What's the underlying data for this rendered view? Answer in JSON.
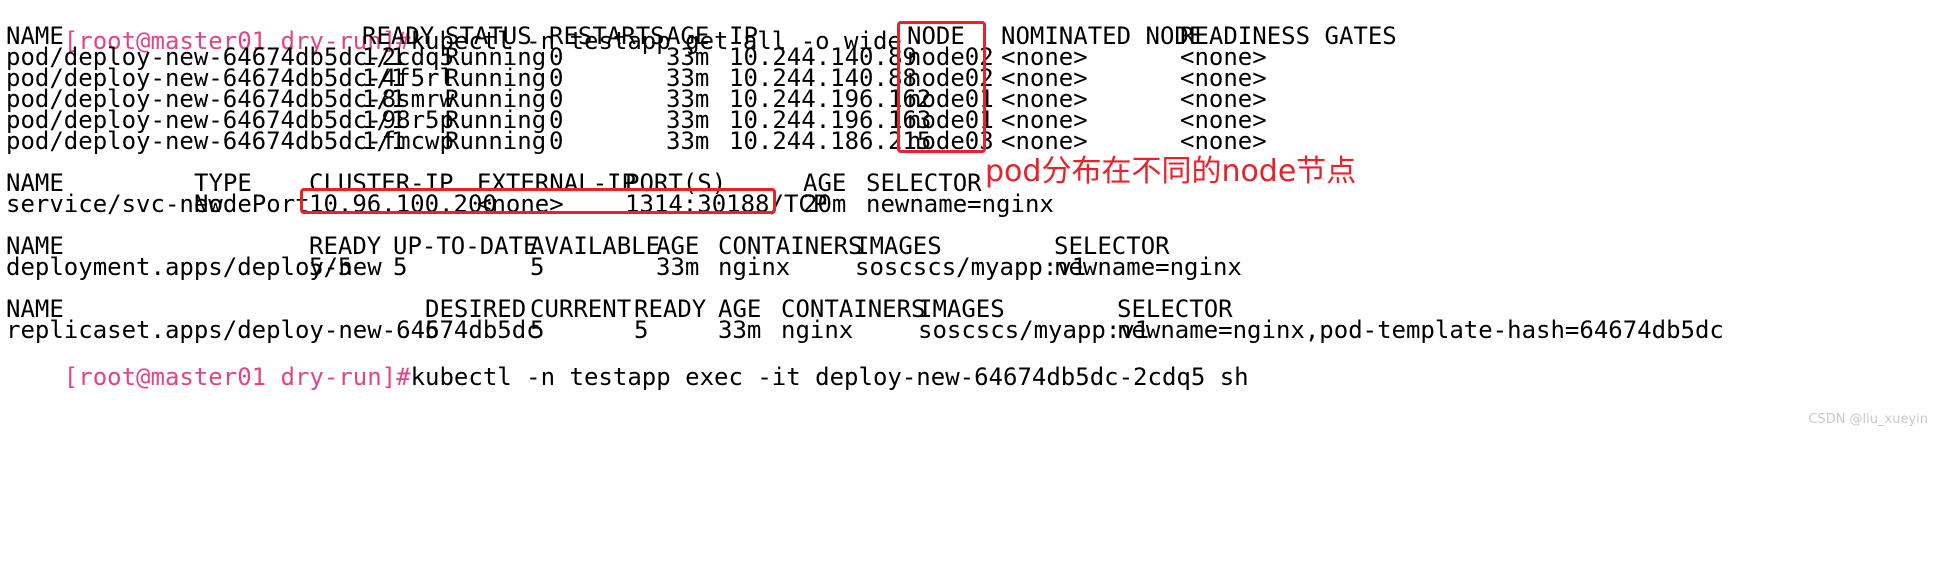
{
  "command_line": {
    "prompt": "[root@master01 dry-run]#",
    "command": "kubectl -n testapp get all -o wide"
  },
  "pods": {
    "headers": [
      "NAME",
      "READY",
      "STATUS",
      "RESTARTS",
      "AGE",
      "IP",
      "NODE",
      "NOMINATED NODE",
      "READINESS GATES"
    ],
    "rows": [
      [
        "pod/deploy-new-64674db5dc-2cdq5",
        "1/1",
        "Running",
        "0",
        "33m",
        "10.244.140.89",
        "node02",
        "<none>",
        "<none>"
      ],
      [
        "pod/deploy-new-64674db5dc-4f5rl",
        "1/1",
        "Running",
        "0",
        "33m",
        "10.244.140.88",
        "node02",
        "<none>",
        "<none>"
      ],
      [
        "pod/deploy-new-64674db5dc-8smrw",
        "1/1",
        "Running",
        "0",
        "33m",
        "10.244.196.162",
        "node01",
        "<none>",
        "<none>"
      ],
      [
        "pod/deploy-new-64674db5dc-98r5p",
        "1/1",
        "Running",
        "0",
        "33m",
        "10.244.196.163",
        "node01",
        "<none>",
        "<none>"
      ],
      [
        "pod/deploy-new-64674db5dc-fmcwp",
        "1/1",
        "Running",
        "0",
        "33m",
        "10.244.186.215",
        "node03",
        "<none>",
        "<none>"
      ]
    ]
  },
  "services": {
    "headers": [
      "NAME",
      "TYPE",
      "CLUSTER-IP",
      "EXTERNAL-IP",
      "PORT(S)",
      "AGE",
      "SELECTOR"
    ],
    "rows": [
      [
        "service/svc-new",
        "NodePort",
        "10.96.100.200",
        "<none>",
        "1314:30188/TCP",
        "20m",
        "newname=nginx"
      ]
    ]
  },
  "deployments": {
    "headers": [
      "NAME",
      "READY",
      "UP-TO-DATE",
      "AVAILABLE",
      "AGE",
      "CONTAINERS",
      "IMAGES",
      "SELECTOR"
    ],
    "rows": [
      [
        "deployment.apps/deploy-new",
        "5/5",
        "5",
        "5",
        "33m",
        "nginx",
        "soscscs/myapp:v1",
        "newname=nginx"
      ]
    ]
  },
  "replicasets": {
    "headers": [
      "NAME",
      "DESIRED",
      "CURRENT",
      "READY",
      "AGE",
      "CONTAINERS",
      "IMAGES",
      "SELECTOR"
    ],
    "rows": [
      [
        "replicaset.apps/deploy-new-64674db5dc",
        "5",
        "5",
        "5",
        "33m",
        "nginx",
        "soscscs/myapp:v1",
        "newname=nginx,pod-template-hash=64674db5dc"
      ]
    ]
  },
  "next_command_line": {
    "prompt": "[root@master01 dry-run]#",
    "command": "kubectl -n testapp exec -it deploy-new-64674db5dc-2cdq5 sh"
  },
  "annotation": {
    "text": "pod分布在不同的node节点",
    "color": "#e8222b"
  },
  "watermark": "CSDN @liu_xueyin",
  "colors": {
    "prompt": "#e0458a",
    "text": "#000000",
    "background": "#ffffff",
    "annotation": "#e8222b"
  }
}
